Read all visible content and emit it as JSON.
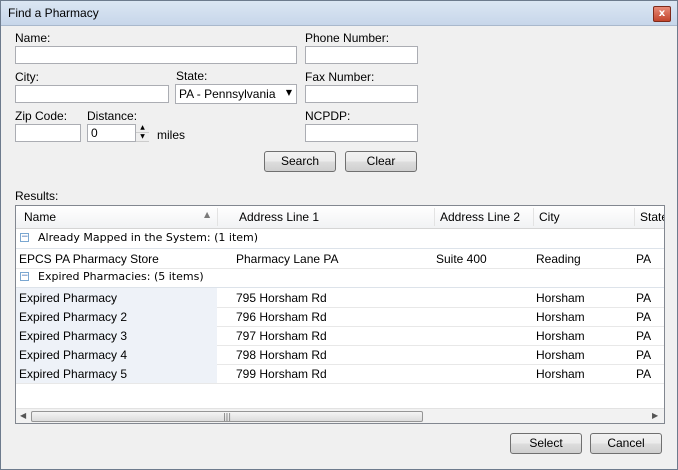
{
  "window": {
    "title": "Find a Pharmacy",
    "close_label": "x"
  },
  "form": {
    "name_label": "Name:",
    "name_value": "",
    "phone_label": "Phone Number:",
    "phone_value": "",
    "city_label": "City:",
    "city_value": "",
    "state_label": "State:",
    "state_value": "PA - Pennsylvania",
    "fax_label": "Fax Number:",
    "fax_value": "",
    "zip_label": "Zip Code:",
    "zip_value": "",
    "distance_label": "Distance:",
    "distance_value": "0",
    "miles_label": "miles",
    "ncpdp_label": "NCPDP:",
    "ncpdp_value": "",
    "search_label": "Search",
    "clear_label": "Clear"
  },
  "results": {
    "label": "Results:",
    "columns": [
      "Name",
      "Address Line 1",
      "Address Line 2",
      "City",
      "State"
    ],
    "groups": [
      {
        "label": "Already Mapped in the System: (1 item)",
        "rows": [
          {
            "name": "EPCS PA Pharmacy Store",
            "address1": "Pharmacy Lane PA",
            "address2": "Suite 400",
            "city": "Reading",
            "state": "PA"
          }
        ]
      },
      {
        "label": "Expired Pharmacies: (5 items)",
        "rows": [
          {
            "name": "Expired Pharmacy",
            "address1": "795 Horsham Rd",
            "address2": "",
            "city": "Horsham",
            "state": "PA"
          },
          {
            "name": "Expired Pharmacy 2",
            "address1": "796 Horsham Rd",
            "address2": "",
            "city": "Horsham",
            "state": "PA"
          },
          {
            "name": "Expired Pharmacy 3",
            "address1": "797 Horsham Rd",
            "address2": "",
            "city": "Horsham",
            "state": "PA"
          },
          {
            "name": "Expired Pharmacy 4",
            "address1": "798 Horsham Rd",
            "address2": "",
            "city": "Horsham",
            "state": "PA"
          },
          {
            "name": "Expired Pharmacy 5",
            "address1": "799 Horsham Rd",
            "address2": "",
            "city": "Horsham",
            "state": "PA"
          }
        ]
      }
    ]
  },
  "footer": {
    "select_label": "Select",
    "cancel_label": "Cancel"
  }
}
